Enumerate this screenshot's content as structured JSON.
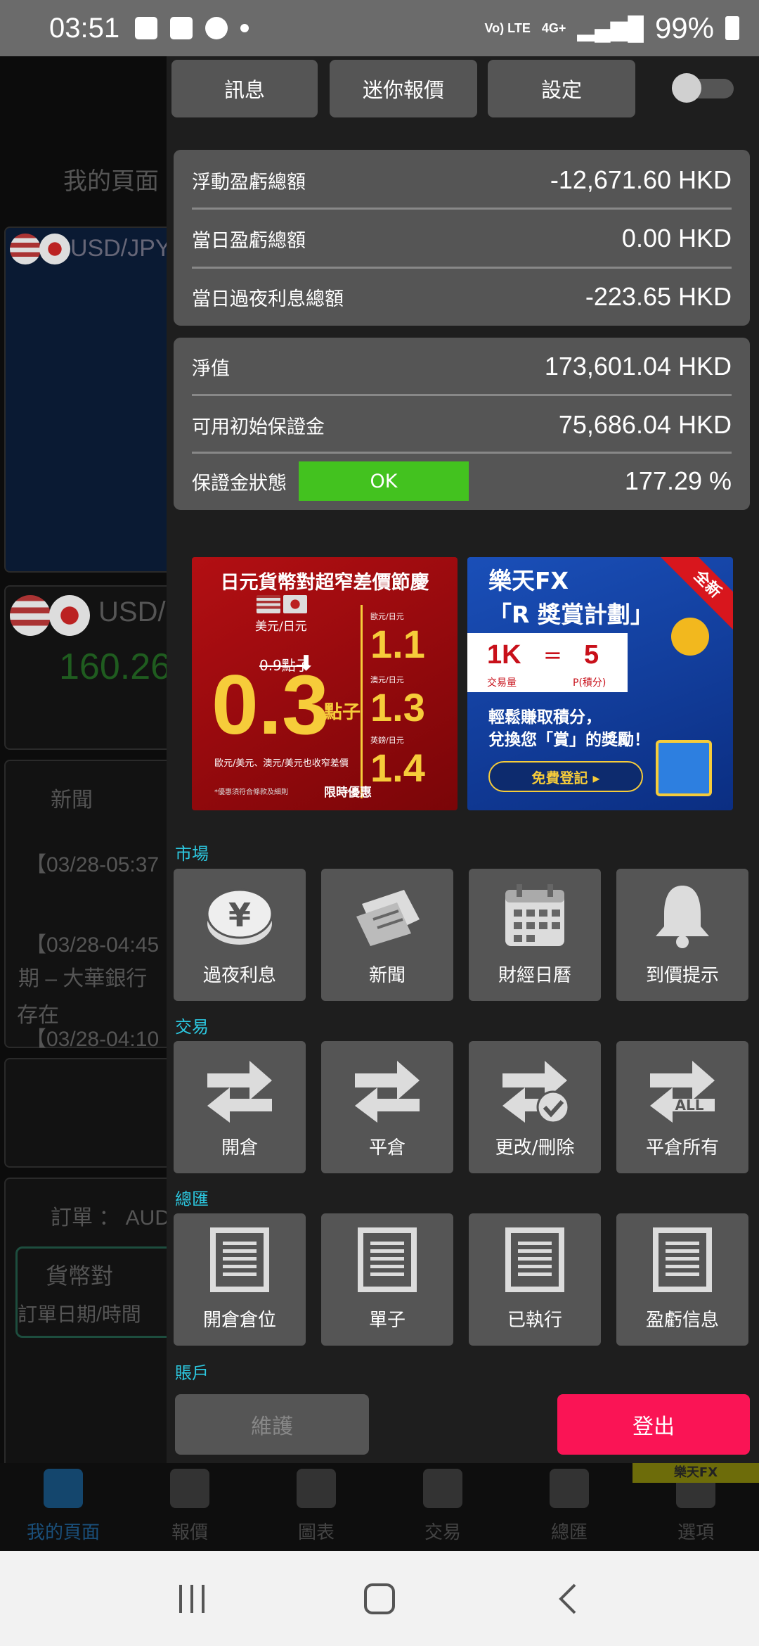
{
  "status_bar": {
    "time": "03:51",
    "volte": "Vo) LTE",
    "network": "4G+",
    "battery": "99%"
  },
  "background": {
    "page_title": "我的頁面",
    "pair1": "USD/JPY",
    "pair2": "USD/",
    "price": "160.26",
    "news_title": "新聞",
    "news": [
      "【03/28-05:37",
      "【03/28-04:45",
      "期 – 大華銀行",
      "【03/28-04:10",
      "存在"
    ],
    "order_label": "訂單 ： AUD",
    "currency_pair_col": "貨幣對",
    "order_date_col": "訂單日期/時間"
  },
  "tabs": [
    "訊息",
    "迷你報價",
    "設定"
  ],
  "summary1": [
    {
      "label": "浮動盈虧總額",
      "value": "-12,671.60 HKD"
    },
    {
      "label": "當日盈虧總額",
      "value": "0.00 HKD"
    },
    {
      "label": "當日過夜利息總額",
      "value": "-223.65 HKD"
    }
  ],
  "summary2": [
    {
      "label": "淨值",
      "value": "173,601.04 HKD"
    },
    {
      "label": "可用初始保證金",
      "value": "75,686.04 HKD"
    },
    {
      "label": "保證金狀態",
      "value": "177.29 %",
      "status": "OK"
    }
  ],
  "banner_red": {
    "title": "日元貨幣對超窄差價節慶",
    "pair": "美元/日元",
    "old": "0.9點子",
    "big": "0.3",
    "unit": "點子",
    "rates": [
      {
        "pair": "歐元/日元",
        "value": "1.1"
      },
      {
        "pair": "澳元/日元",
        "value": "1.3"
      },
      {
        "pair": "英鎊/日元",
        "value": "1.4"
      }
    ],
    "note": "歐元/美元、澳元/美元也收窄差價",
    "limit": "限時優惠",
    "fine": "*優惠須符合條款及細則"
  },
  "banner_blue": {
    "title": "樂天FX\n「R 獎賞計劃」",
    "ribbon": "全新",
    "k": "1K",
    "eq": "=",
    "v": "5",
    "k_label": "交易量",
    "v_label": "P(積分)",
    "text": "輕鬆賺取積分，\n兌換您「賞」的獎勵！",
    "button": "免費登記 ▸"
  },
  "sections": [
    {
      "title": "市場",
      "items": [
        {
          "label": "過夜利息",
          "icon": "yen-coin-icon"
        },
        {
          "label": "新聞",
          "icon": "newspaper-icon"
        },
        {
          "label": "財經日曆",
          "icon": "calendar-icon"
        },
        {
          "label": "到價提示",
          "icon": "bell-icon"
        }
      ]
    },
    {
      "title": "交易",
      "items": [
        {
          "label": "開倉",
          "icon": "swap-arrows-icon"
        },
        {
          "label": "平倉",
          "icon": "swap-arrows-icon"
        },
        {
          "label": "更改/刪除",
          "icon": "swap-check-icon"
        },
        {
          "label": "平倉所有",
          "icon": "swap-all-icon"
        }
      ]
    },
    {
      "title": "總匯",
      "items": [
        {
          "label": "開倉倉位",
          "icon": "list-doc-icon"
        },
        {
          "label": "單子",
          "icon": "list-doc-icon"
        },
        {
          "label": "已執行",
          "icon": "list-doc-icon"
        },
        {
          "label": "盈虧信息",
          "icon": "list-doc-icon"
        }
      ]
    }
  ],
  "account_title": "賬戶",
  "maintenance_label": "維護",
  "logout_label": "登出",
  "brand_tag": "樂天FX",
  "bottom_nav": [
    "我的頁面",
    "報價",
    "圖表",
    "交易",
    "總匯",
    "選項"
  ],
  "colors": {
    "accent_cyan": "#2cc8e0",
    "ok_green": "#43c21f",
    "logout_red": "#fa1455",
    "tile_gray": "#555555"
  }
}
